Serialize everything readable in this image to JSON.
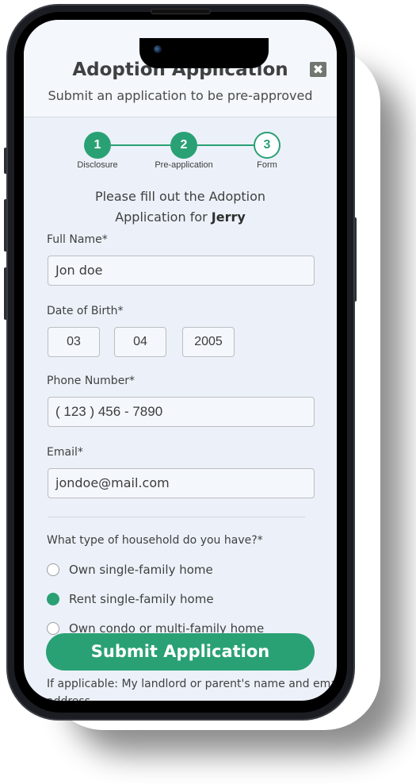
{
  "header": {
    "title": "Adoption Application",
    "subtitle": "Submit an application to be pre-approved",
    "close_icon": "close-x-icon"
  },
  "stepper": {
    "steps": [
      {
        "number": "1",
        "label": "Disclosure",
        "state": "completed"
      },
      {
        "number": "2",
        "label": "Pre-application",
        "state": "completed"
      },
      {
        "number": "3",
        "label": "Form",
        "state": "current"
      }
    ]
  },
  "intro": {
    "line1": "Please fill out the Adoption",
    "line2_prefix": "Application for ",
    "pet_name": "Jerry"
  },
  "form": {
    "full_name": {
      "label": "Full Name*",
      "value": "Jon doe"
    },
    "dob": {
      "label": "Date of Birth*",
      "month": "03",
      "day": "04",
      "year": "2005"
    },
    "phone": {
      "label": "Phone Number*",
      "value": "( 123 ) 456 - 7890"
    },
    "email": {
      "label": "Email*",
      "value": "jondoe@mail.com"
    },
    "household": {
      "question": "What type of household do you have?*",
      "options": [
        {
          "label": "Own single-family home",
          "selected": false
        },
        {
          "label": "Rent single-family home",
          "selected": true
        },
        {
          "label": "Own condo or multi-family home",
          "selected": false
        }
      ]
    },
    "landlord_label_line1": "If applicable: My landlord or parent's name and email",
    "landlord_label_line2": "address"
  },
  "actions": {
    "submit_label": "Submit Application"
  },
  "colors": {
    "accent": "#2aa174",
    "close_button": "#6f7770",
    "screen_bg": "#ecf1f9",
    "header_bg": "#f4f7fb"
  }
}
